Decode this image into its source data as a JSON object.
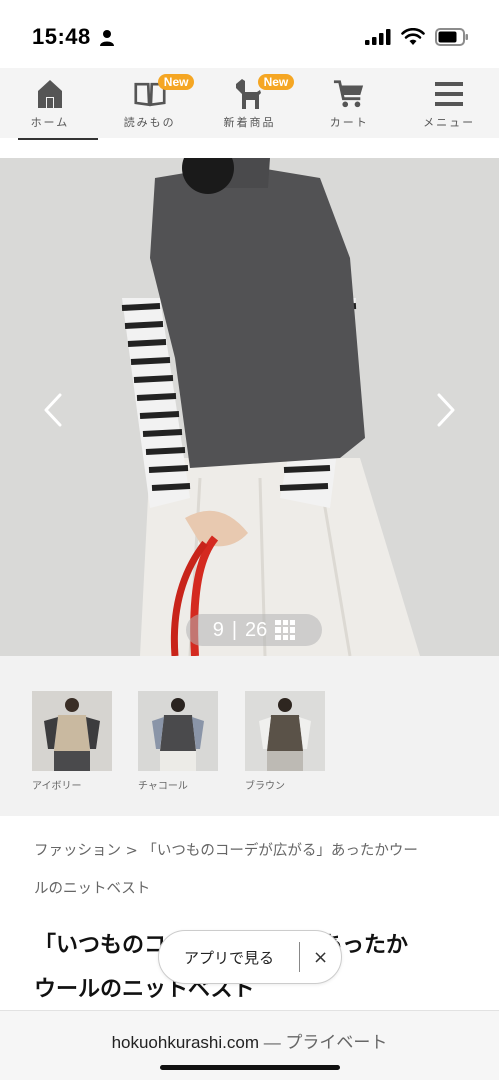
{
  "status_bar": {
    "time": "15:48",
    "icons": [
      "person-icon",
      "signal-icon",
      "wifi-icon",
      "battery-icon"
    ]
  },
  "nav": {
    "items": [
      {
        "label": "ホーム",
        "icon": "home-icon",
        "badge": ""
      },
      {
        "label": "読みもの",
        "icon": "book-icon",
        "badge": "New"
      },
      {
        "label": "新着商品",
        "icon": "horse-icon",
        "badge": "New"
      },
      {
        "label": "カート",
        "icon": "cart-icon",
        "badge": ""
      },
      {
        "label": "メニュー",
        "icon": "menu-icon",
        "badge": ""
      }
    ],
    "badge_color": "#f5a623"
  },
  "gallery": {
    "current": "9",
    "separator": "|",
    "total": "26",
    "prev_icon": "chevron-left-icon",
    "next_icon": "chevron-right-icon",
    "grid_icon": "grid-icon"
  },
  "thumbnails": [
    {
      "label": "アイボリー",
      "vest_color": "#c9b9a0"
    },
    {
      "label": "チャコール",
      "vest_color": "#4a4a4c"
    },
    {
      "label": "ブラウン",
      "vest_color": "#5a5248"
    }
  ],
  "breadcrumb": {
    "line1": "ファッション > 「いつものコーデが広がる」あったかウー",
    "line2": "ルのニットベスト"
  },
  "product": {
    "title_line1": "「いつものコーデが広がる」あったか",
    "title_line2": "ウールのニットベスト"
  },
  "app_prompt": {
    "label": "アプリで見る",
    "close": "×"
  },
  "browser": {
    "domain": "hokuohkurashi.com",
    "suffix": " — プライベート"
  }
}
